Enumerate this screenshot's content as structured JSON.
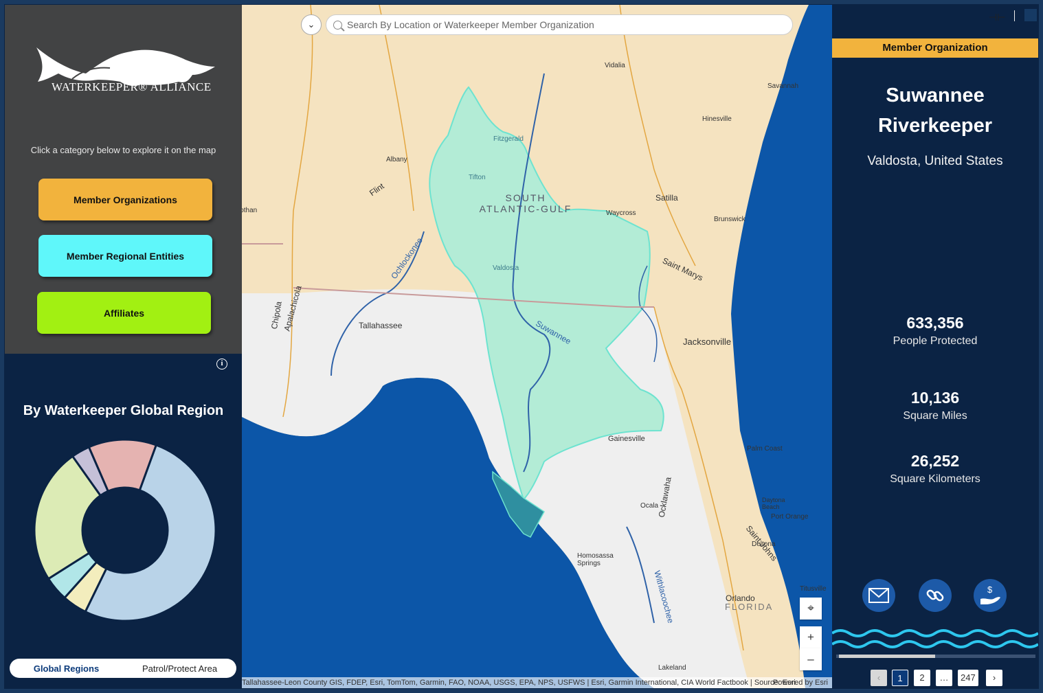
{
  "left_panel": {
    "brand": "WATERKEEPER® ALLIANCE",
    "hint": "Click a category below to explore it on the map",
    "categories": [
      {
        "label": "Member Organizations",
        "color": "#f2b33d"
      },
      {
        "label": "Member Regional Entities",
        "color": "#5ff7fa"
      },
      {
        "label": "Affiliates",
        "color": "#a2f012"
      }
    ],
    "chart_title": "By Waterkeeper Global Region",
    "toggle": {
      "options": [
        "Global Regions",
        "Patrol/Protect Area"
      ],
      "active": "Global Regions"
    }
  },
  "chart_data": {
    "type": "pie",
    "title": "By Waterkeeper Global Region",
    "donut": true,
    "slices": [
      {
        "value": 47,
        "color": "#b9d3e8"
      },
      {
        "value": 4,
        "color": "#f3edbd"
      },
      {
        "value": 4,
        "color": "#b1e6e8"
      },
      {
        "value": 22,
        "color": "#dcebb5"
      },
      {
        "value": 3,
        "color": "#c5c0d8"
      },
      {
        "value": 11,
        "color": "#e5b3b1"
      }
    ]
  },
  "map": {
    "search_placeholder": "Search By Location or Waterkeeper Member Organization",
    "labels": [
      "Tallahassee",
      "Jacksonville",
      "Gainesville",
      "Valdosta",
      "Tifton",
      "Fitzgerald",
      "Albany",
      "Waycross",
      "Hinesville",
      "Savannah",
      "Brunswick",
      "Vidalia",
      "Dothan",
      "Ocala",
      "Orlando",
      "Lakeland",
      "Palm Coast",
      "Daytona Beach",
      "Port Orange",
      "Deltona",
      "Titusville",
      "Homosassa Springs",
      "Ochlockonee",
      "Suwannee",
      "Satilla",
      "Saint Marys",
      "Flint",
      "Chipola",
      "Apalachicola",
      "Withlacoochee",
      "Ocklawaha",
      "Saint Johns",
      "FLORIDA",
      "SOUTH ATLANTIC-GULF"
    ],
    "attribution": "Tallahassee-Leon County GIS, FDEP, Esri, TomTom, Garmin, FAO, NOAA, USGS, EPA, NPS, USFWS | Esri, Garmin International, CIA World Factbook | Source: Esri",
    "powered_by": "Powered by Esri",
    "zoom_in": "+",
    "zoom_out": "–"
  },
  "right_panel": {
    "header": "Member Organization",
    "org_name": "Suwannee Riverkeeper",
    "location": "Valdosta, United States",
    "stats": [
      {
        "value": "633,356",
        "label": "People Protected"
      },
      {
        "value": "10,136",
        "label": "Square Miles"
      },
      {
        "value": "26,252",
        "label": "Square Kilometers"
      }
    ],
    "actions": [
      "email-icon",
      "link-icon",
      "donate-icon"
    ],
    "pagination": {
      "prev": "‹",
      "pages": [
        "1",
        "2",
        "…",
        "247"
      ],
      "current": "1",
      "next": "›"
    }
  }
}
